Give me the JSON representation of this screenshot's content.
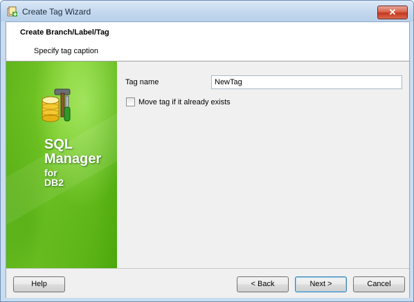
{
  "window": {
    "title": "Create Tag Wizard",
    "close_glyph": "✕"
  },
  "header": {
    "title": "Create Branch/Label/Tag",
    "subtitle": "Specify tag caption"
  },
  "banner": {
    "line1": "SQL",
    "line2": "Manager",
    "line3": "for",
    "line4": "DB2",
    "logo_icon": "database-hammer-screwdriver-icon"
  },
  "form": {
    "tag_name_label": "Tag name",
    "tag_name_value": "NewTag",
    "move_tag_label": "Move tag if it already exists",
    "move_tag_checked": false
  },
  "footer": {
    "help_label": "Help",
    "back_label": "< Back",
    "next_label": "Next >",
    "cancel_label": "Cancel"
  },
  "colors": {
    "banner_green": "#6cc21f",
    "title_bar": "#c5d9ef",
    "close_red": "#c4391f"
  }
}
